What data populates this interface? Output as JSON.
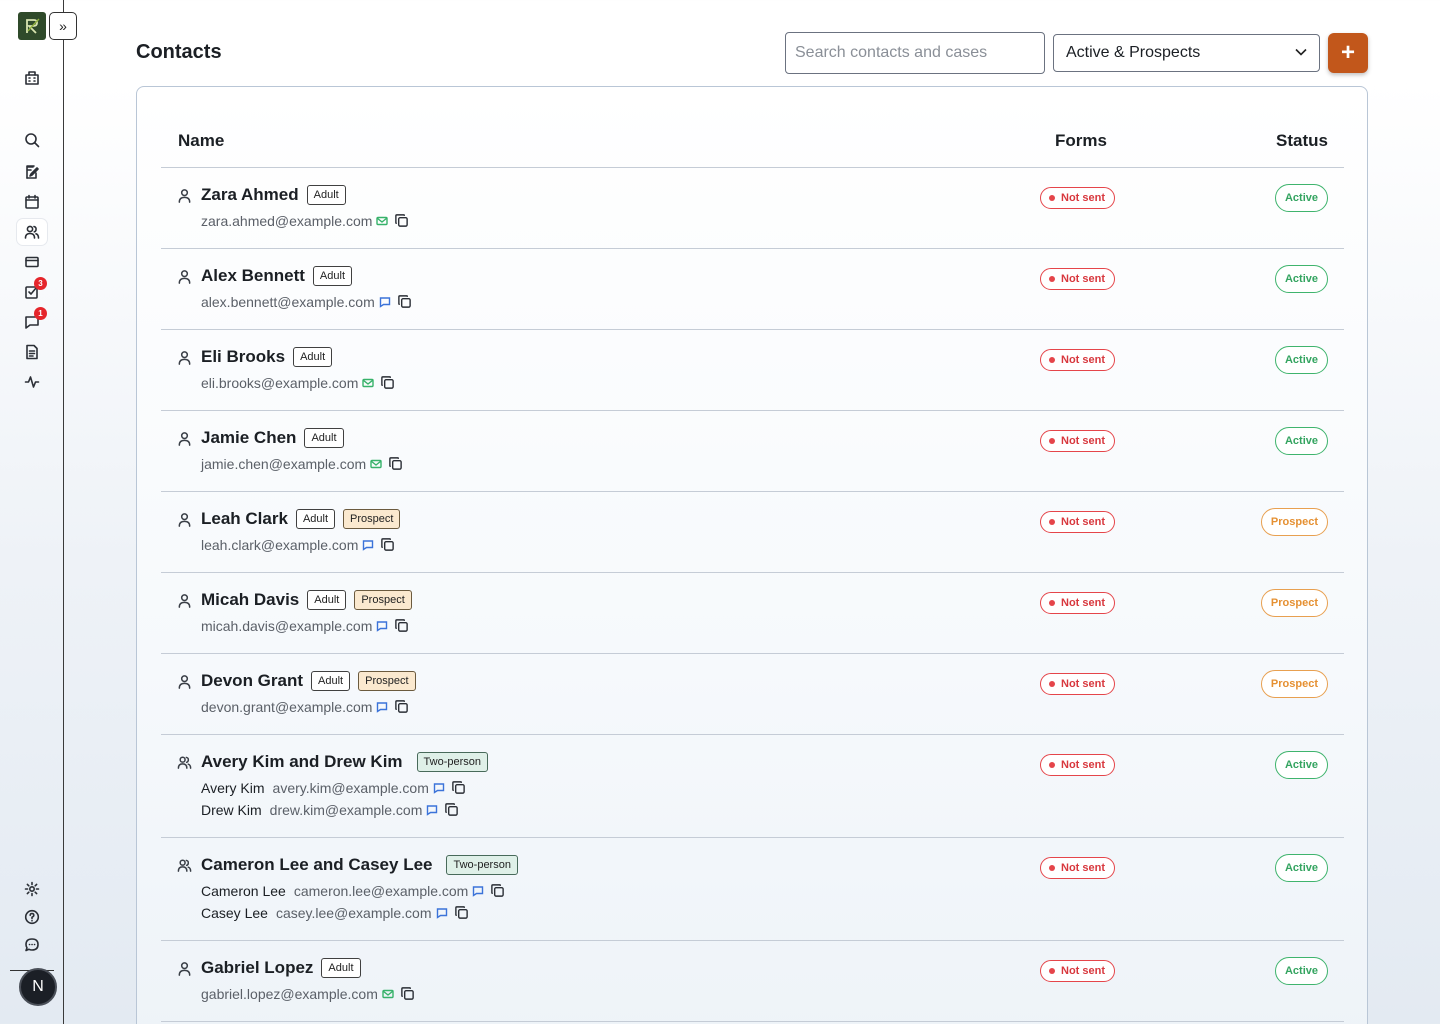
{
  "header": {
    "title": "Contacts",
    "search_placeholder": "Search contacts and cases",
    "filter_value": "Active & Prospects",
    "add_label": "+"
  },
  "sidebar": {
    "expand_label": "»",
    "items": [
      {
        "name": "building-icon"
      },
      {
        "name": "search-icon"
      },
      {
        "name": "edit-note-icon"
      },
      {
        "name": "calendar-icon"
      },
      {
        "name": "contacts-icon"
      },
      {
        "name": "card-icon"
      },
      {
        "name": "tasks-icon",
        "badge": "3"
      },
      {
        "name": "messages-icon",
        "badge": "1"
      },
      {
        "name": "document-icon"
      },
      {
        "name": "activity-icon"
      }
    ],
    "bottom": [
      {
        "name": "settings-icon"
      },
      {
        "name": "help-icon"
      },
      {
        "name": "chat-icon"
      }
    ],
    "avatar_initial": "N"
  },
  "table": {
    "columns": {
      "name": "Name",
      "forms": "Forms",
      "status": "Status"
    },
    "rows": [
      {
        "name": "Zara Ahmed",
        "tags": [
          "Adult"
        ],
        "emails": [
          {
            "who": "",
            "email": "zara.ahmed@example.com",
            "channel": "mail"
          }
        ],
        "forms": "Not sent",
        "status": "Active"
      },
      {
        "name": "Alex Bennett",
        "tags": [
          "Adult"
        ],
        "emails": [
          {
            "who": "",
            "email": "alex.bennett@example.com",
            "channel": "chat"
          }
        ],
        "forms": "Not sent",
        "status": "Active"
      },
      {
        "name": "Eli Brooks",
        "tags": [
          "Adult"
        ],
        "emails": [
          {
            "who": "",
            "email": "eli.brooks@example.com",
            "channel": "mail"
          }
        ],
        "forms": "Not sent",
        "status": "Active"
      },
      {
        "name": "Jamie Chen",
        "tags": [
          "Adult"
        ],
        "emails": [
          {
            "who": "",
            "email": "jamie.chen@example.com",
            "channel": "mail"
          }
        ],
        "forms": "Not sent",
        "status": "Active"
      },
      {
        "name": "Leah Clark",
        "tags": [
          "Adult",
          "Prospect"
        ],
        "emails": [
          {
            "who": "",
            "email": "leah.clark@example.com",
            "channel": "chat"
          }
        ],
        "forms": "Not sent",
        "status": "Prospect"
      },
      {
        "name": "Micah Davis",
        "tags": [
          "Adult",
          "Prospect"
        ],
        "emails": [
          {
            "who": "",
            "email": "micah.davis@example.com",
            "channel": "chat"
          }
        ],
        "forms": "Not sent",
        "status": "Prospect"
      },
      {
        "name": "Devon Grant",
        "tags": [
          "Adult",
          "Prospect"
        ],
        "emails": [
          {
            "who": "",
            "email": "devon.grant@example.com",
            "channel": "chat"
          }
        ],
        "forms": "Not sent",
        "status": "Prospect"
      },
      {
        "name": "Avery Kim and Drew Kim",
        "tags": [
          "Two-person"
        ],
        "emails": [
          {
            "who": "Avery Kim",
            "email": "avery.kim@example.com",
            "channel": "chat"
          },
          {
            "who": "Drew Kim",
            "email": "drew.kim@example.com",
            "channel": "chat"
          }
        ],
        "forms": "Not sent",
        "status": "Active"
      },
      {
        "name": "Cameron Lee and Casey Lee",
        "tags": [
          "Two-person"
        ],
        "emails": [
          {
            "who": "Cameron Lee",
            "email": "cameron.lee@example.com",
            "channel": "chat"
          },
          {
            "who": "Casey Lee",
            "email": "casey.lee@example.com",
            "channel": "chat"
          }
        ],
        "forms": "Not sent",
        "status": "Active"
      },
      {
        "name": "Gabriel Lopez",
        "tags": [
          "Adult"
        ],
        "emails": [
          {
            "who": "",
            "email": "gabriel.lopez@example.com",
            "channel": "mail"
          }
        ],
        "forms": "Not sent",
        "status": "Active"
      }
    ]
  }
}
